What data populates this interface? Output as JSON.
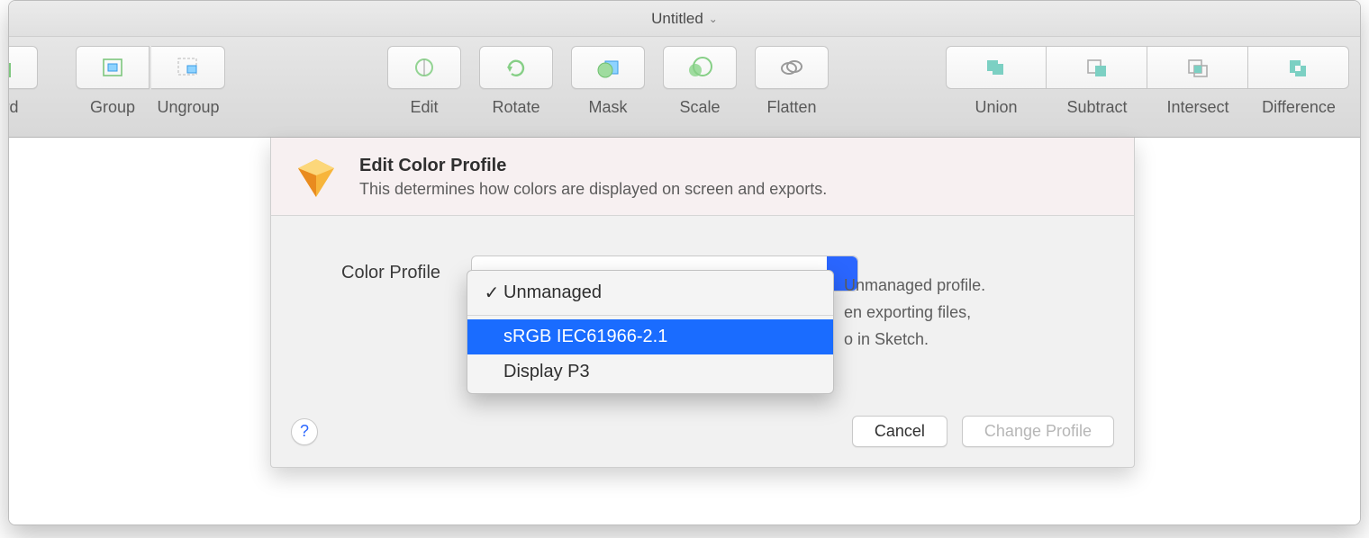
{
  "window": {
    "title": "Untitled"
  },
  "toolbar": {
    "forward": "ward",
    "group": "Group",
    "ungroup": "Ungroup",
    "edit": "Edit",
    "rotate": "Rotate",
    "mask": "Mask",
    "scale": "Scale",
    "flatten": "Flatten",
    "union": "Union",
    "subtract": "Subtract",
    "intersect": "Intersect",
    "difference": "Difference"
  },
  "dialog": {
    "title": "Edit Color Profile",
    "subtitle": "This determines how colors are displayed on screen and exports.",
    "row_label": "Color Profile",
    "desc_line1": "Unmanaged profile.",
    "desc_line2": "en exporting files,",
    "desc_line3": "o in Sketch.",
    "cancel": "Cancel",
    "confirm": "Change Profile"
  },
  "menu": {
    "items": [
      {
        "label": "Unmanaged",
        "checked": true,
        "highlight": false
      },
      {
        "label": "sRGB IEC61966-2.1",
        "checked": false,
        "highlight": true
      },
      {
        "label": "Display P3",
        "checked": false,
        "highlight": false
      }
    ]
  }
}
